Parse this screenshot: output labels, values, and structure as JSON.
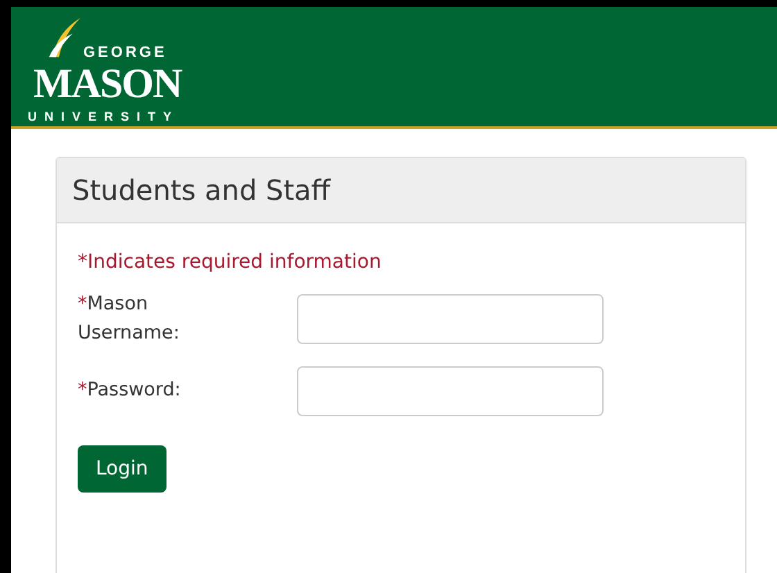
{
  "logo": {
    "top": "GEORGE",
    "main": "MASON",
    "bottom": "UNIVERSITY"
  },
  "panel": {
    "title": "Students and Staff",
    "note": "*Indicates required information",
    "fields": [
      {
        "marker": "*",
        "label": "Mason Username:"
      },
      {
        "marker": "*",
        "label": "Password:"
      }
    ],
    "button": "Login"
  }
}
